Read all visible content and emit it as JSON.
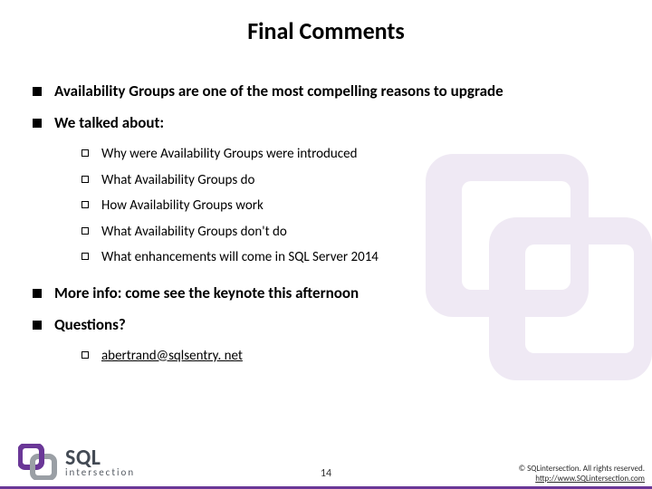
{
  "title": "Final Comments",
  "bullets": {
    "b1": "Availability Groups are one of the most compelling reasons to upgrade",
    "b2": "We talked about:",
    "sub1": "Why were Availability Groups were introduced",
    "sub2": "What Availability Groups do",
    "sub3": "How Availability Groups work",
    "sub4": "What Availability Groups don't do",
    "sub5": "What enhancements will come in SQL Server 2014",
    "b3": "More info: come see the keynote this afternoon",
    "b4": "Questions?",
    "email": "abertrand@sqlsentry. net"
  },
  "logo": {
    "primary": "SQL",
    "secondary": "intersection"
  },
  "page": "14",
  "footer": {
    "copyright": "© SQLintersection. All rights reserved.",
    "url": "http://www.SQLintersection.com"
  }
}
